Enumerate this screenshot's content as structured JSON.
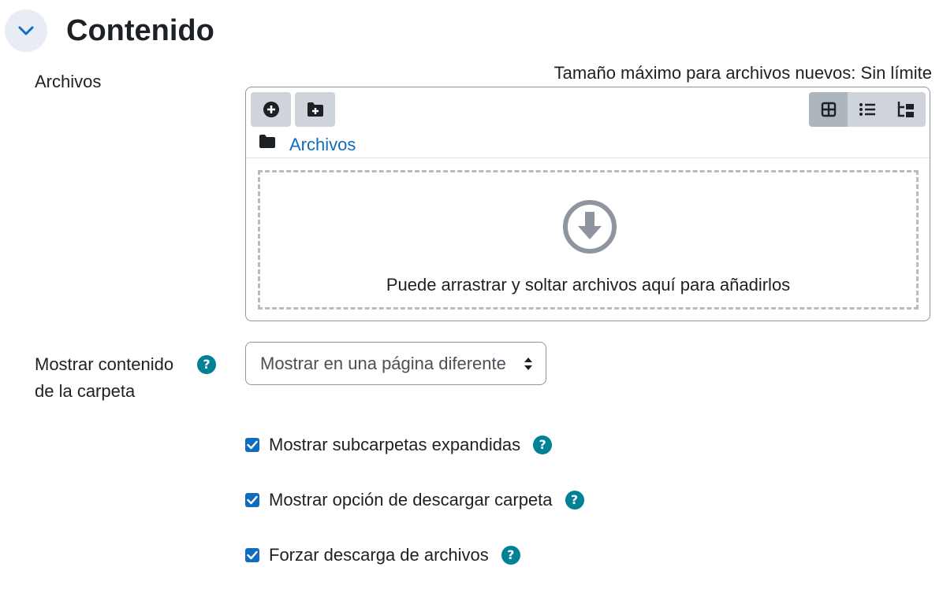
{
  "section": {
    "title": "Contenido",
    "collapse_icon": "chevron-down-icon"
  },
  "files_field": {
    "label": "Archivos",
    "max_size_text": "Tamaño máximo para archivos nuevos: Sin límite",
    "toolbar": {
      "add_file_icon": "plus-circle-icon",
      "new_folder_icon": "folder-plus-icon",
      "views": [
        "grid-view-icon",
        "list-view-icon",
        "tree-view-icon"
      ],
      "active_view": "grid-view-icon"
    },
    "breadcrumb": {
      "icon": "folder-icon",
      "link": "Archivos"
    },
    "dropzone": {
      "icon": "download-circle-icon",
      "text": "Puede arrastrar y soltar archivos aquí para añadirlos"
    }
  },
  "display_field": {
    "label_line1": "Mostrar contenido",
    "label_line2": "de la carpeta",
    "help_glyph": "?",
    "selected_option": "Mostrar en una página diferente"
  },
  "checkboxes": [
    {
      "label": "Mostrar subcarpetas expandidas",
      "checked": true
    },
    {
      "label": "Mostrar opción de descargar carpeta",
      "checked": true
    },
    {
      "label": "Forzar descarga de archivos",
      "checked": true
    }
  ],
  "colors": {
    "link": "#0f6cbf",
    "help_badge": "#008196",
    "checkbox": "#0f6cbf",
    "collapse_bg": "#e7ecf5"
  }
}
